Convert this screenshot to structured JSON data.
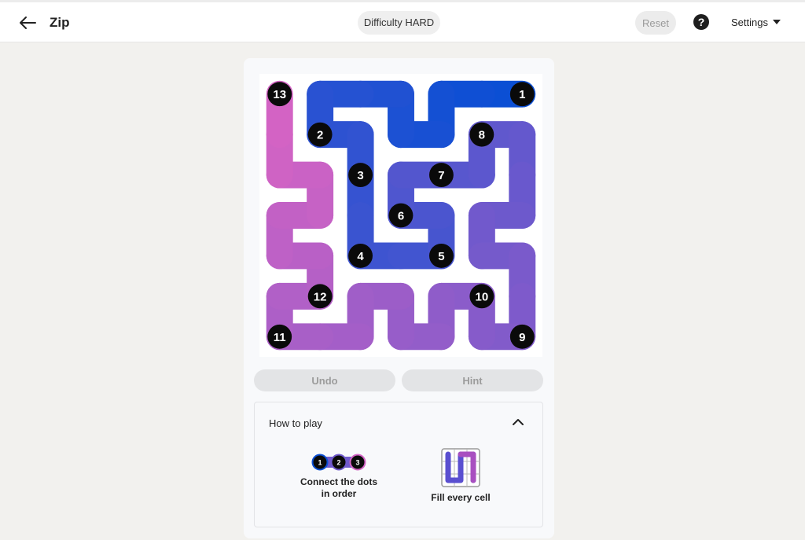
{
  "header": {
    "title": "Zip",
    "difficulty": "Difficulty HARD",
    "reset_label": "Reset",
    "help_label": "?",
    "settings_label": "Settings"
  },
  "board": {
    "rows": 7,
    "cols": 7,
    "path_color_start": "#0b4fd4",
    "path_color_end": "#d363c4",
    "dots": [
      {
        "label": "1",
        "row": 0,
        "col": 6
      },
      {
        "label": "2",
        "row": 1,
        "col": 1
      },
      {
        "label": "3",
        "row": 2,
        "col": 2
      },
      {
        "label": "4",
        "row": 4,
        "col": 2
      },
      {
        "label": "5",
        "row": 4,
        "col": 4
      },
      {
        "label": "6",
        "row": 3,
        "col": 3
      },
      {
        "label": "7",
        "row": 2,
        "col": 4
      },
      {
        "label": "8",
        "row": 1,
        "col": 5
      },
      {
        "label": "9",
        "row": 6,
        "col": 6
      },
      {
        "label": "10",
        "row": 5,
        "col": 5
      },
      {
        "label": "11",
        "row": 6,
        "col": 0
      },
      {
        "label": "12",
        "row": 5,
        "col": 1
      },
      {
        "label": "13",
        "row": 0,
        "col": 0
      }
    ],
    "path": [
      [
        0,
        6
      ],
      [
        0,
        5
      ],
      [
        0,
        4
      ],
      [
        1,
        4
      ],
      [
        1,
        3
      ],
      [
        0,
        3
      ],
      [
        0,
        2
      ],
      [
        0,
        1
      ],
      [
        1,
        1
      ],
      [
        1,
        2
      ],
      [
        2,
        2
      ],
      [
        3,
        2
      ],
      [
        4,
        2
      ],
      [
        4,
        3
      ],
      [
        4,
        4
      ],
      [
        3,
        4
      ],
      [
        3,
        3
      ],
      [
        2,
        3
      ],
      [
        2,
        4
      ],
      [
        2,
        5
      ],
      [
        1,
        5
      ],
      [
        1,
        6
      ],
      [
        2,
        6
      ],
      [
        3,
        6
      ],
      [
        3,
        5
      ],
      [
        4,
        5
      ],
      [
        4,
        6
      ],
      [
        5,
        6
      ],
      [
        6,
        6
      ],
      [
        6,
        5
      ],
      [
        5,
        5
      ],
      [
        5,
        4
      ],
      [
        6,
        4
      ],
      [
        6,
        3
      ],
      [
        5,
        3
      ],
      [
        5,
        2
      ],
      [
        6,
        2
      ],
      [
        6,
        1
      ],
      [
        6,
        0
      ],
      [
        5,
        0
      ],
      [
        5,
        1
      ],
      [
        4,
        1
      ],
      [
        4,
        0
      ],
      [
        3,
        0
      ],
      [
        3,
        1
      ],
      [
        2,
        1
      ],
      [
        2,
        0
      ],
      [
        1,
        0
      ],
      [
        0,
        0
      ]
    ]
  },
  "controls": {
    "undo_label": "Undo",
    "hint_label": "Hint"
  },
  "how_to_play": {
    "title": "How to play",
    "step1_text": "Connect the dots in order",
    "step1_dots": [
      "1",
      "2",
      "3"
    ],
    "step2_text": "Fill every cell"
  }
}
